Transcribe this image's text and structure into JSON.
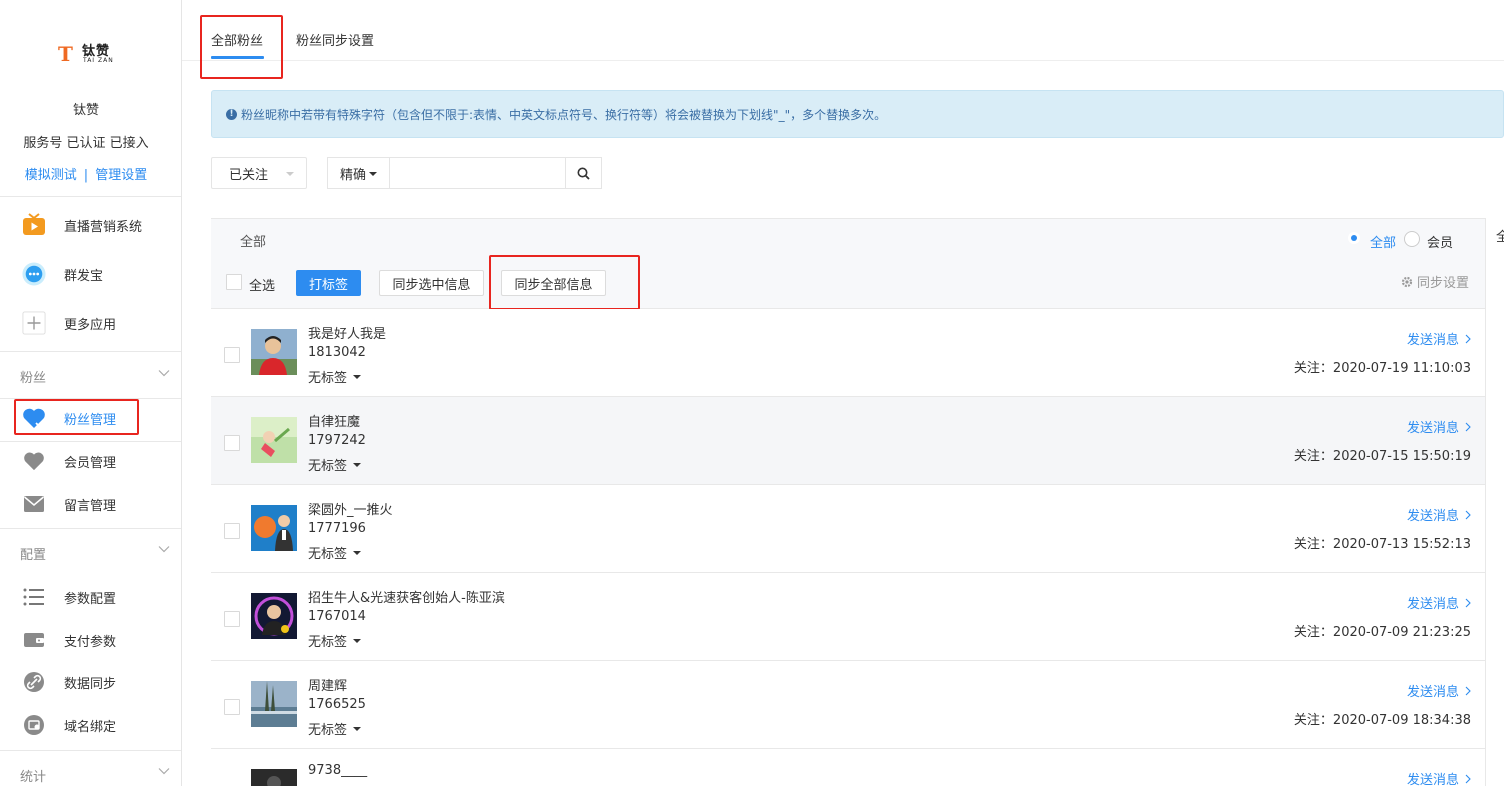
{
  "brand": {
    "mark": "T",
    "name_cn": "钛赞",
    "name_en": "TAI ZAN"
  },
  "account": {
    "name": "钛赞",
    "status": "服务号 已认证 已接入",
    "link_test": "模拟测试",
    "link_divider": "|",
    "link_settings": "管理设置"
  },
  "sidebar": {
    "apps": [
      {
        "label": "直播营销系统",
        "icon": "live-tv-icon"
      },
      {
        "label": "群发宝",
        "icon": "chat-bubble-icon"
      },
      {
        "label": "更多应用",
        "icon": "plus-icon"
      }
    ],
    "fans_group": {
      "title": "粉丝",
      "items": [
        {
          "label": "粉丝管理",
          "icon": "heart-icon",
          "active": true
        },
        {
          "label": "会员管理",
          "icon": "heart-icon",
          "active": false
        },
        {
          "label": "留言管理",
          "icon": "mail-icon",
          "active": false
        }
      ]
    },
    "config_group": {
      "title": "配置",
      "items": [
        {
          "label": "参数配置",
          "icon": "list-icon"
        },
        {
          "label": "支付参数",
          "icon": "wallet-icon"
        },
        {
          "label": "数据同步",
          "icon": "link-icon"
        },
        {
          "label": "域名绑定",
          "icon": "domain-icon"
        }
      ]
    },
    "stats_group": {
      "title": "统计"
    }
  },
  "tabs": [
    {
      "label": "全部粉丝",
      "active": true
    },
    {
      "label": "粉丝同步设置",
      "active": false
    }
  ],
  "notice": "粉丝昵称中若带有特殊字符（包含但不限于:表情、中英文标点符号、换行符等）将会被替换为下划线\"_\"，多个替换多次。",
  "filters": {
    "follow_select": "已关注",
    "match_mode": "精确",
    "search_value": "",
    "scope_label": "全部",
    "radio_all": "全部",
    "radio_member": "会员"
  },
  "toolbar": {
    "select_all": "全选",
    "tag_button": "打标签",
    "sync_selected": "同步选中信息",
    "sync_all": "同步全部信息",
    "sync_settings": "同步设置"
  },
  "right_strip_text": "全",
  "fans": [
    {
      "nickname": "我是好人我是",
      "id": "1813042",
      "tag": "无标签",
      "send": "发送消息",
      "follow": "关注：2020-07-19 11:10:03"
    },
    {
      "nickname": "自律狂魔",
      "id": "1797242",
      "tag": "无标签",
      "send": "发送消息",
      "follow": "关注：2020-07-15 15:50:19"
    },
    {
      "nickname": "梁圆外_一推火",
      "id": "1777196",
      "tag": "无标签",
      "send": "发送消息",
      "follow": "关注：2020-07-13 15:52:13"
    },
    {
      "nickname": "招生牛人&光速获客创始人-陈亚滨",
      "id": "1767014",
      "tag": "无标签",
      "send": "发送消息",
      "follow": "关注：2020-07-09 21:23:25"
    },
    {
      "nickname": "周建辉",
      "id": "1766525",
      "tag": "无标签",
      "send": "发送消息",
      "follow": "关注：2020-07-09 18:34:38"
    },
    {
      "nickname": "9738____",
      "id": "",
      "tag": "",
      "send": "发送消息",
      "follow": ""
    }
  ],
  "colors": {
    "accent": "#2d8cf0",
    "highlight_box": "#e8251f",
    "notice_bg": "#d9edf7"
  }
}
